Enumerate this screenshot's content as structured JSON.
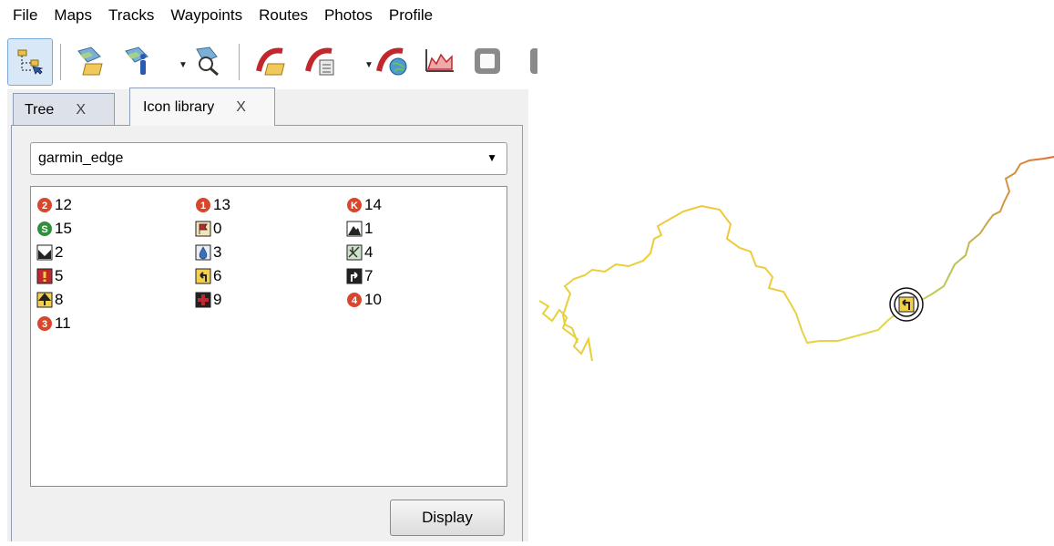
{
  "menu": [
    "File",
    "Maps",
    "Tracks",
    "Waypoints",
    "Routes",
    "Photos",
    "Profile"
  ],
  "tabs": [
    {
      "label": "Tree",
      "close": "X"
    },
    {
      "label": "Icon library",
      "close": "X"
    }
  ],
  "icon_set": {
    "selected": "garmin_edge"
  },
  "icons": [
    {
      "label": "12",
      "icon": "circle-number-2",
      "color": "#d9462b"
    },
    {
      "label": "13",
      "icon": "circle-number-1",
      "color": "#d9462b"
    },
    {
      "label": "14",
      "icon": "circle-k",
      "color": "#d9462b"
    },
    {
      "label": "15",
      "icon": "circle-s",
      "color": "#2f8f3a"
    },
    {
      "label": "0",
      "icon": "flag-square",
      "color": "#c0282d"
    },
    {
      "label": "1",
      "icon": "mountain-square",
      "color": "#222222"
    },
    {
      "label": "2",
      "icon": "valley-square",
      "color": "#222222"
    },
    {
      "label": "3",
      "icon": "water-drop-square",
      "color": "#3b6fb6"
    },
    {
      "label": "4",
      "icon": "food-square",
      "color": "#2f8f3a"
    },
    {
      "label": "5",
      "icon": "warning-square",
      "color": "#c0282d"
    },
    {
      "label": "6",
      "icon": "left-turn-square",
      "color": "#f2d04b"
    },
    {
      "label": "7",
      "icon": "right-turn-square",
      "color": "#222222"
    },
    {
      "label": "8",
      "icon": "straight-arrow-square",
      "color": "#f2d04b"
    },
    {
      "label": "9",
      "icon": "first-aid-square",
      "color": "#c0282d"
    },
    {
      "label": "10",
      "icon": "circle-number-4",
      "color": "#d9462b"
    },
    {
      "label": "11",
      "icon": "circle-number-3",
      "color": "#d9462b"
    }
  ],
  "buttons": {
    "display": "Display"
  }
}
